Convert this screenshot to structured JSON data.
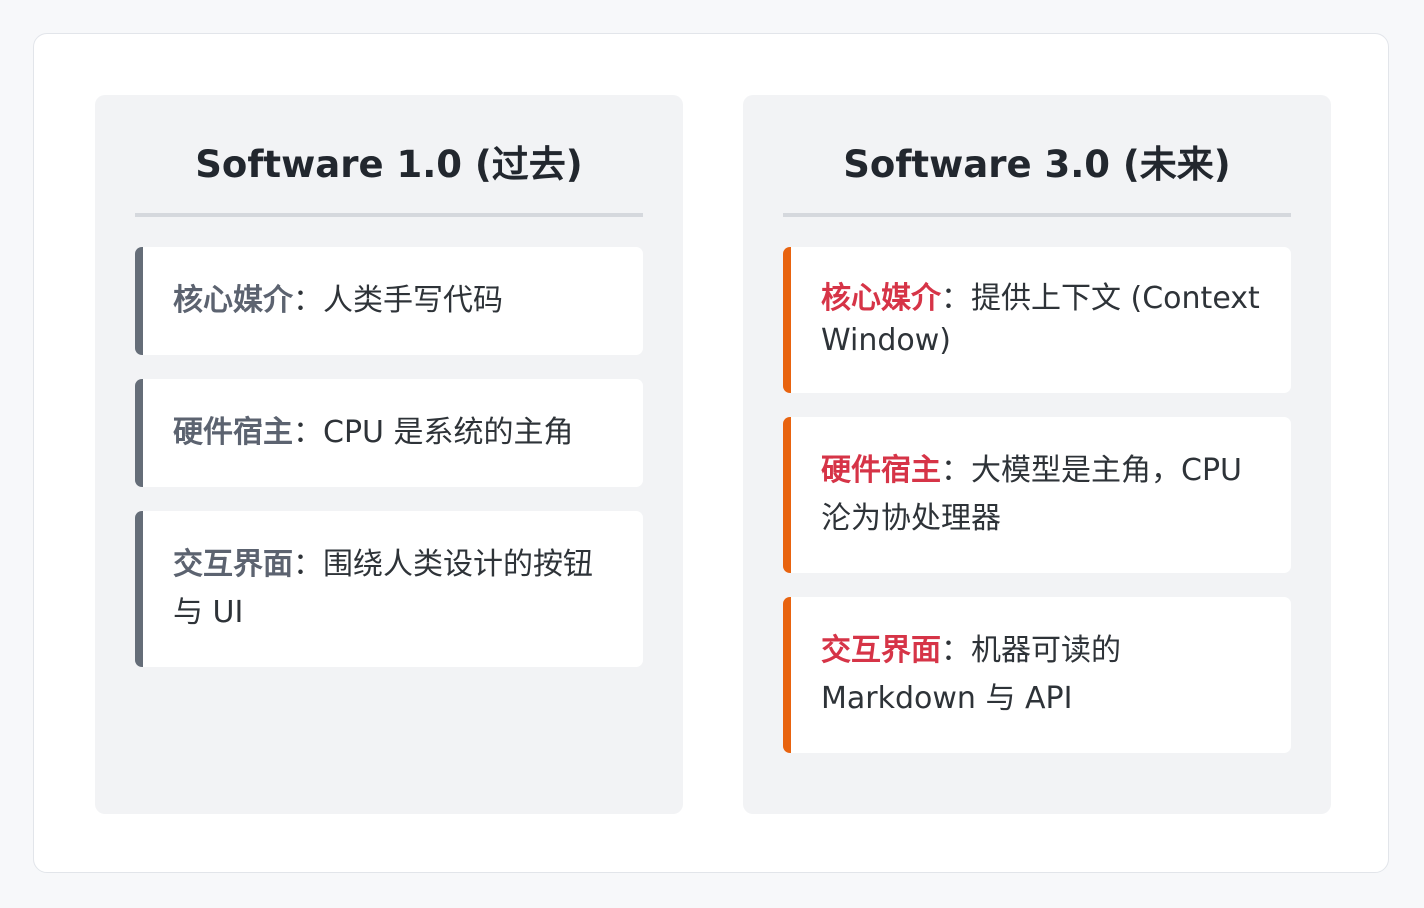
{
  "left": {
    "title": "Software 1.0 (过去)",
    "items": [
      {
        "label": "核心媒介",
        "sep": "：",
        "text": "人类手写代码"
      },
      {
        "label": "硬件宿主",
        "sep": "：",
        "text": "CPU 是系统的主角"
      },
      {
        "label": "交互界面",
        "sep": "：",
        "text": "围绕人类设计的按钮与 UI"
      }
    ]
  },
  "right": {
    "title": "Software 3.0 (未来)",
    "items": [
      {
        "label": "核心媒介",
        "sep": "：",
        "text": "提供上下文 (Context Window)"
      },
      {
        "label": "硬件宿主",
        "sep": "：",
        "text": "大模型是主角，CPU 沦为协处理器"
      },
      {
        "label": "交互界面",
        "sep": "：",
        "text": "机器可读的 Markdown 与 API"
      }
    ]
  },
  "colors": {
    "left_accent": "#656d78",
    "right_accent": "#e8630f",
    "right_label": "#d63447"
  }
}
